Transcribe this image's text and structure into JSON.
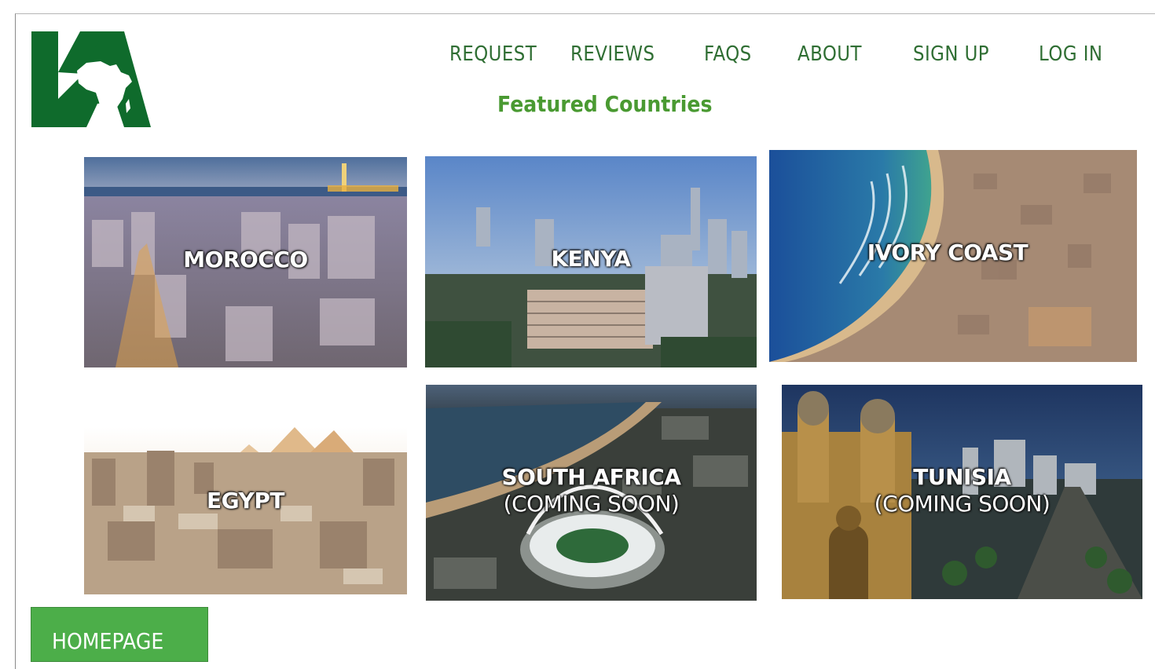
{
  "brand": {
    "logo_text": "KA",
    "color": "#0f6b2c"
  },
  "nav": {
    "request": "REQUEST",
    "reviews": "REVIEWS",
    "faqs": "FAQS",
    "about": "ABOUT",
    "signup": "SIGN UP",
    "login": "LOG IN"
  },
  "section": {
    "title": "Featured Countries"
  },
  "countries": {
    "morocco": {
      "label": "MOROCCO"
    },
    "kenya": {
      "label": "KENYA"
    },
    "ivory_coast": {
      "label": "IVORY COAST"
    },
    "egypt": {
      "label": "EGYPT"
    },
    "south_africa": {
      "label": "SOUTH AFRICA",
      "status": "(COMING SOON)"
    },
    "tunisia": {
      "label": "TUNISIA",
      "status": "(COMING SOON)"
    }
  },
  "footer": {
    "homepage_label": "HOMEPAGE"
  },
  "colors": {
    "nav_text": "#2f6e33",
    "title": "#4a9a32",
    "button": "#4cae49"
  }
}
